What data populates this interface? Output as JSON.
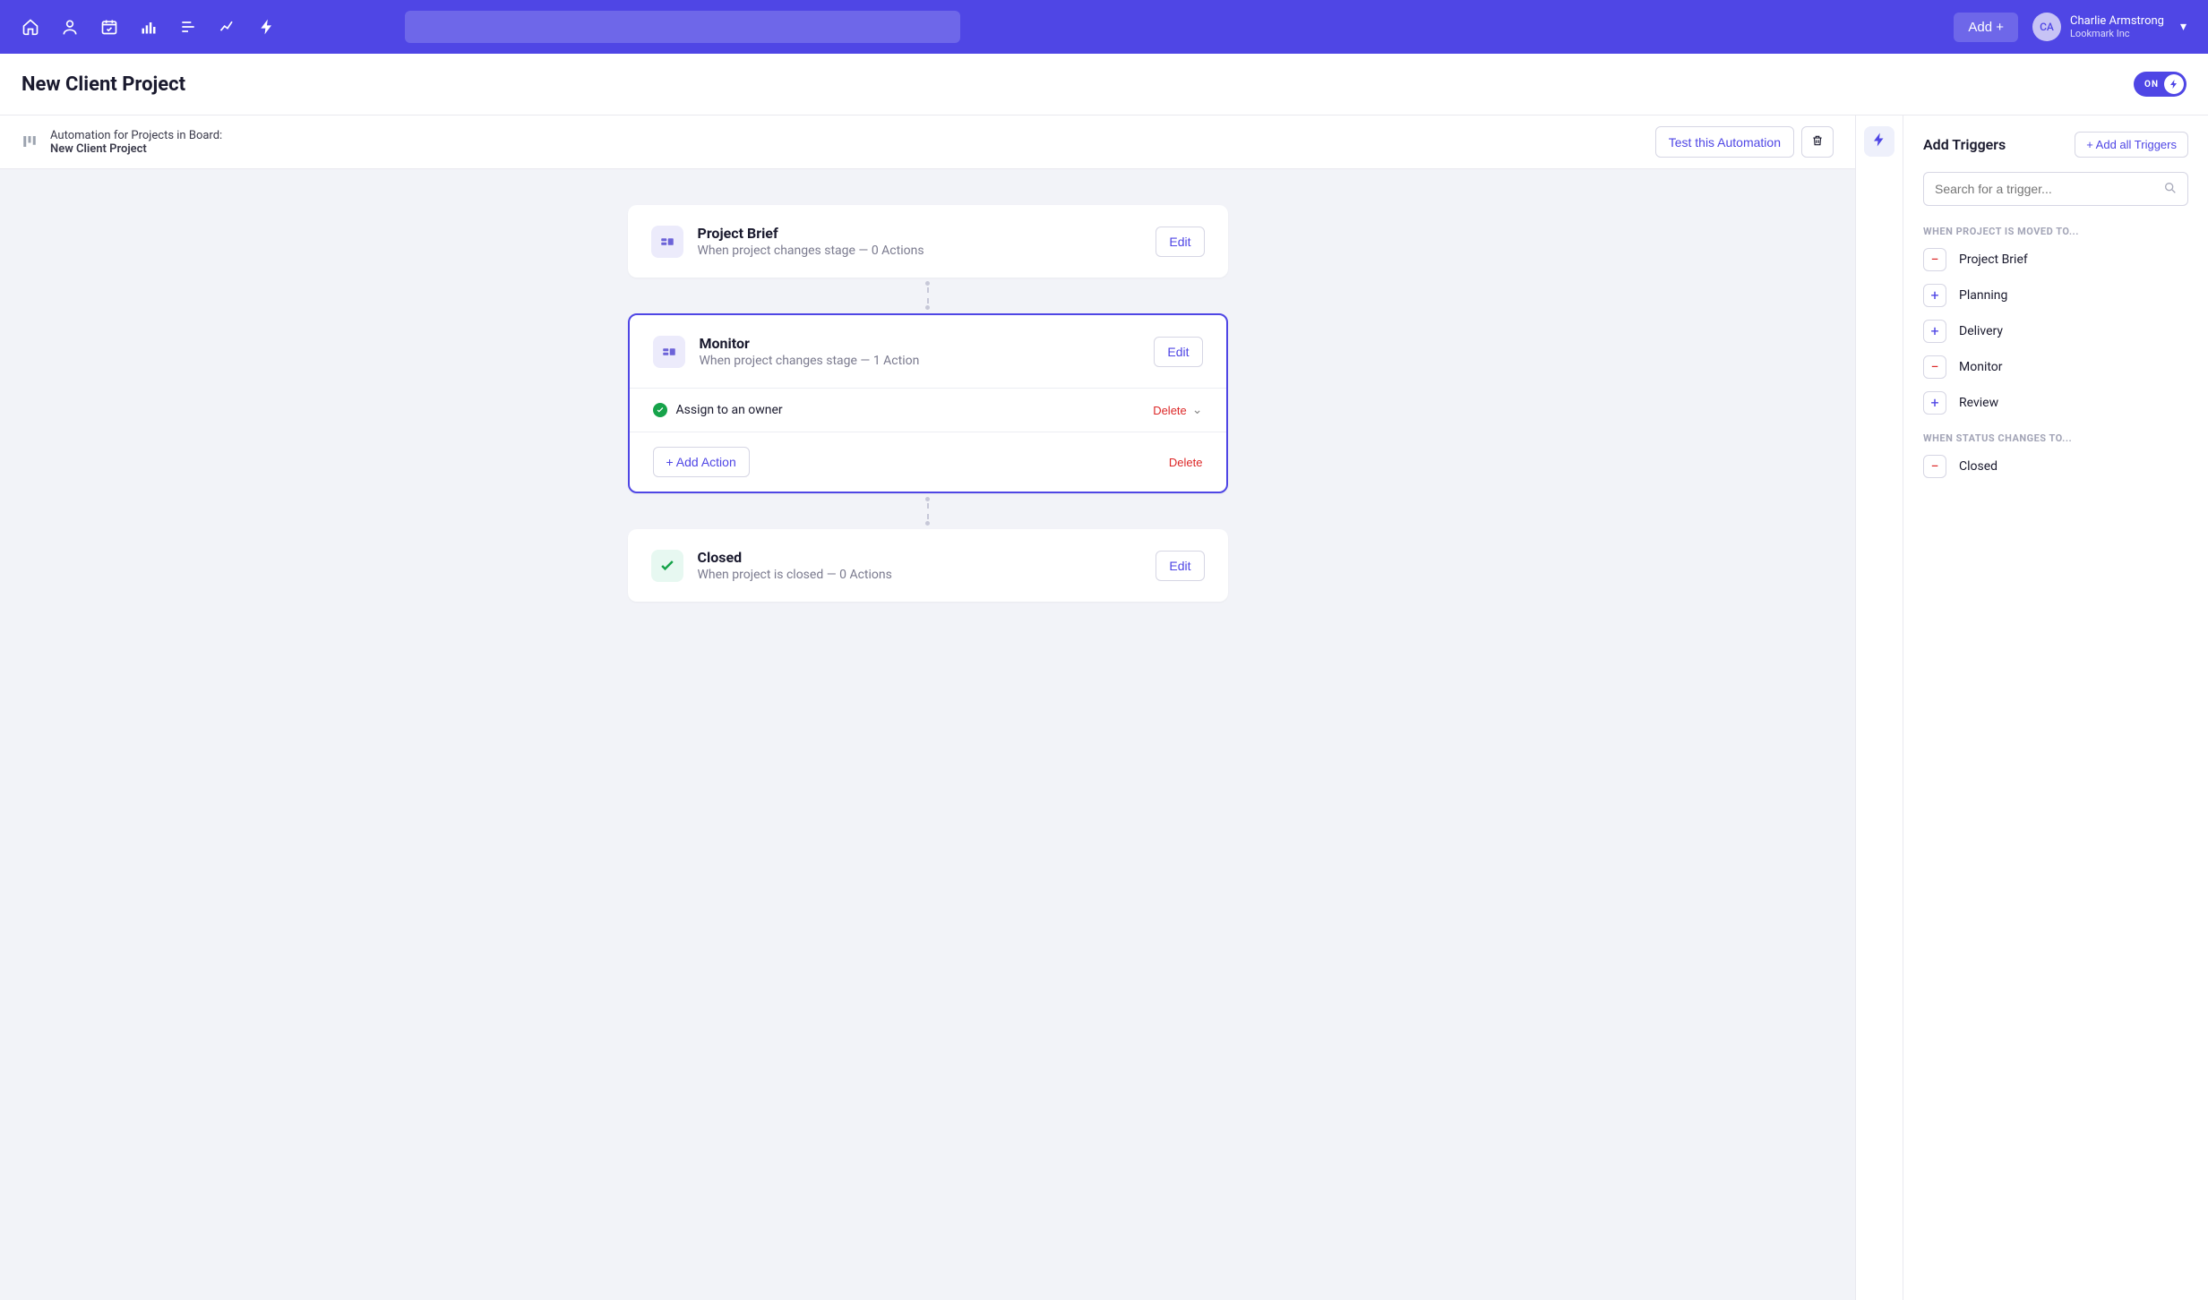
{
  "user": {
    "initials": "CA",
    "name": "Charlie Armstrong",
    "org": "Lookmark Inc"
  },
  "add_button": "Add +",
  "page_title": "New Client Project",
  "toggle_label": "ON",
  "automation_bar": {
    "prefix": "Automation for Projects in Board:",
    "board": "New Client Project",
    "test_button": "Test this Automation"
  },
  "cards": [
    {
      "title": "Project Brief",
      "subtitle": "When project changes stage — 0 Actions",
      "edit": "Edit",
      "icon": "board"
    },
    {
      "title": "Monitor",
      "subtitle": "When project changes stage — 1 Action",
      "edit": "Edit",
      "icon": "board",
      "selected": true,
      "action_row": {
        "label": "Assign to an owner",
        "delete": "Delete"
      },
      "foot": {
        "add_action": "+ Add Action",
        "delete": "Delete"
      }
    },
    {
      "title": "Closed",
      "subtitle": "When project is closed — 0 Actions",
      "edit": "Edit",
      "icon": "check"
    }
  ],
  "panel": {
    "title": "Add Triggers",
    "add_all": "+ Add all Triggers",
    "search_placeholder": "Search for a trigger...",
    "section1": "WHEN PROJECT IS MOVED TO...",
    "section2": "WHEN STATUS CHANGES TO...",
    "move_triggers": [
      {
        "label": "Project Brief",
        "sign": "minus"
      },
      {
        "label": "Planning",
        "sign": "plus"
      },
      {
        "label": "Delivery",
        "sign": "plus"
      },
      {
        "label": "Monitor",
        "sign": "minus"
      },
      {
        "label": "Review",
        "sign": "plus"
      }
    ],
    "status_triggers": [
      {
        "label": "Closed",
        "sign": "minus"
      }
    ]
  }
}
